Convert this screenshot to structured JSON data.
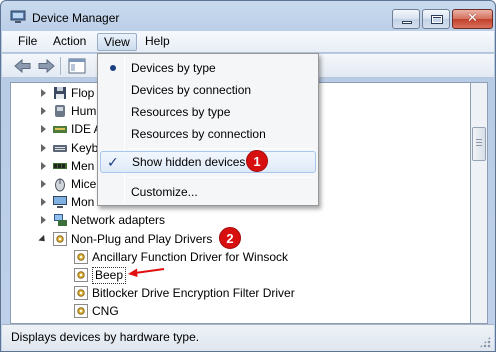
{
  "window": {
    "title": "Device Manager"
  },
  "menubar": {
    "items": [
      {
        "label": "File"
      },
      {
        "label": "Action"
      },
      {
        "label": "View"
      },
      {
        "label": "Help"
      }
    ]
  },
  "view_menu": {
    "items": [
      {
        "label": "Devices by type",
        "marker": "radio-selected"
      },
      {
        "label": "Devices by connection"
      },
      {
        "label": "Resources by type"
      },
      {
        "label": "Resources by connection"
      },
      {
        "label": "Show hidden devices",
        "marker": "checked"
      },
      {
        "label": "Customize..."
      }
    ]
  },
  "annotations": {
    "badge1": "1",
    "badge2": "2"
  },
  "tree": {
    "items": [
      {
        "label": "Floppy disk drives",
        "visible_label": "Flop",
        "icon": "floppy-icon",
        "expanded": false
      },
      {
        "label": "Human Interface Devices",
        "visible_label": "Hum",
        "icon": "hid-icon",
        "expanded": false
      },
      {
        "label": "IDE ATA/ATAPI controllers",
        "visible_label": "IDE A",
        "icon": "ide-icon",
        "expanded": false
      },
      {
        "label": "Keyboards",
        "visible_label": "Keyb",
        "icon": "keyboard-icon",
        "expanded": false
      },
      {
        "label": "Memory technology devices",
        "visible_label": "Men",
        "icon": "memory-icon",
        "expanded": false
      },
      {
        "label": "Mice and other pointing devices",
        "visible_label": "Mice",
        "icon": "mouse-icon",
        "expanded": false
      },
      {
        "label": "Monitors",
        "visible_label": "Mon",
        "icon": "monitor-icon",
        "expanded": false
      },
      {
        "label": "Network adapters",
        "visible_label": "Network adapters",
        "icon": "network-icon",
        "expanded": false
      },
      {
        "label": "Non-Plug and Play Drivers",
        "visible_label": "Non-Plug and Play Drivers",
        "icon": "driver-icon",
        "expanded": true
      },
      {
        "label": "Ancillary Function Driver for Winsock",
        "icon": "driver-icon",
        "child": true
      },
      {
        "label": "Beep",
        "icon": "driver-icon",
        "child": true,
        "selected": true
      },
      {
        "label": "Bitlocker Drive Encryption Filter Driver",
        "icon": "driver-icon",
        "child": true
      },
      {
        "label": "CNG",
        "icon": "driver-icon",
        "child": true
      }
    ]
  },
  "statusbar": {
    "text": "Displays devices by hardware type."
  },
  "colors": {
    "badge": "#d80f0f",
    "arrow": "#e01010",
    "accent": "#1a3f80"
  }
}
